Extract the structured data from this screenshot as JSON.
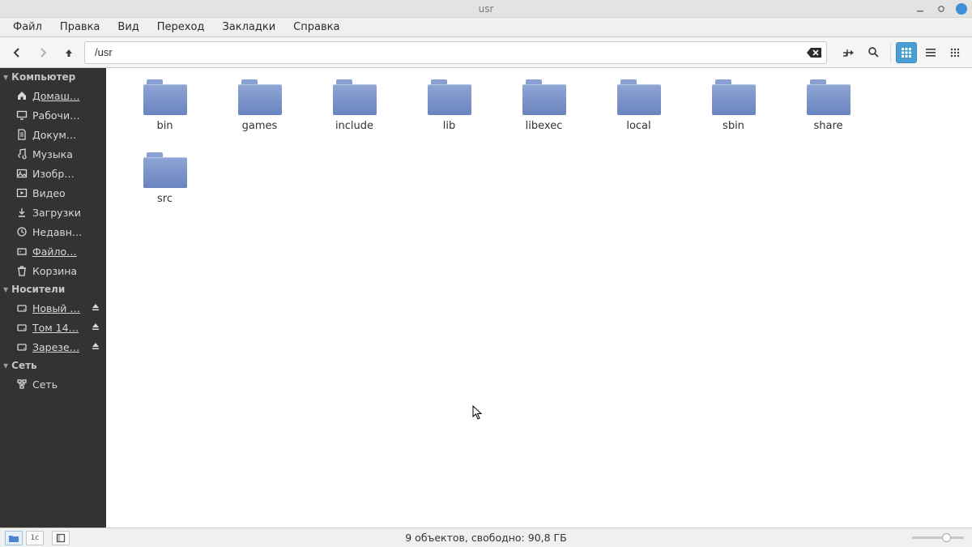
{
  "window": {
    "title": "usr"
  },
  "menu": {
    "items": [
      "Файл",
      "Правка",
      "Вид",
      "Переход",
      "Закладки",
      "Справка"
    ]
  },
  "toolbar": {
    "path": "/usr"
  },
  "sidebar": {
    "sections": [
      {
        "heading": "Компьютер",
        "items": [
          {
            "icon": "home",
            "label": "Домаш…",
            "underlined": true
          },
          {
            "icon": "desktop",
            "label": "Рабочи…"
          },
          {
            "icon": "documents",
            "label": "Докум…"
          },
          {
            "icon": "music",
            "label": "Музыка"
          },
          {
            "icon": "pictures",
            "label": "Изобр…"
          },
          {
            "icon": "videos",
            "label": "Видео"
          },
          {
            "icon": "downloads",
            "label": "Загрузки"
          },
          {
            "icon": "recent",
            "label": "Недавн…"
          },
          {
            "icon": "filesystem",
            "label": "Файло…",
            "underlined": true
          },
          {
            "icon": "trash",
            "label": "Корзина"
          }
        ]
      },
      {
        "heading": "Носители",
        "items": [
          {
            "icon": "drive",
            "label": "Новый …",
            "underlined": true,
            "eject": true
          },
          {
            "icon": "drive",
            "label": "Том 14…",
            "underlined": true,
            "eject": true
          },
          {
            "icon": "drive",
            "label": "Зарезе…",
            "underlined": true,
            "eject": true
          }
        ]
      },
      {
        "heading": "Сеть",
        "items": [
          {
            "icon": "network",
            "label": "Сеть"
          }
        ]
      }
    ]
  },
  "folders": [
    {
      "name": "bin"
    },
    {
      "name": "games"
    },
    {
      "name": "include"
    },
    {
      "name": "lib"
    },
    {
      "name": "libexec"
    },
    {
      "name": "local"
    },
    {
      "name": "sbin"
    },
    {
      "name": "share"
    },
    {
      "name": "src"
    }
  ],
  "status": {
    "text": "9 объектов, свободно: 90,8 ГБ"
  }
}
